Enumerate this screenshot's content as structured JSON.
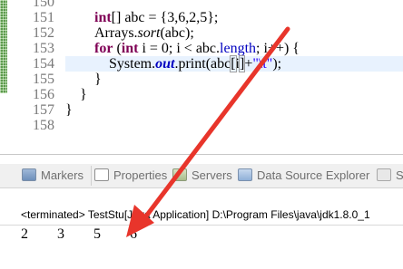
{
  "editor": {
    "line_numbers": [
      "150",
      "151",
      "152",
      "153",
      "154",
      "155",
      "156",
      "157",
      "158"
    ],
    "code": {
      "l151": {
        "kw": "int",
        "rest": "[] abc = {3,6,2,5};"
      },
      "l152": {
        "prefix": "Arrays.",
        "method": "sort",
        "rest": "(abc);"
      },
      "l153": {
        "kw1": "for",
        "open": " (",
        "kw2": "int",
        "mid": " i = 0; i < abc.",
        "field": "length",
        "rest": "; i++) {"
      },
      "l154": {
        "prefix": "System.",
        "field": "out",
        "mid": ".print(abc",
        "bracket_open": "[",
        "idx": "i",
        "bracket_close": "]",
        "plus": "+",
        "str": "\"\\t\"",
        "rest": ");"
      },
      "l155": {
        "text": "}"
      },
      "l156": {
        "text": "}"
      },
      "l157": {
        "text": "}"
      }
    }
  },
  "views": {
    "tabs": [
      {
        "label": "Markers",
        "icon": "markers-icon"
      },
      {
        "label": "Properties",
        "icon": "properties-icon"
      },
      {
        "label": "Servers",
        "icon": "servers-icon"
      },
      {
        "label": "Data Source Explorer",
        "icon": "data-source-explorer-icon"
      },
      {
        "label": "S",
        "icon": "snippets-icon"
      }
    ],
    "console": {
      "header": "<terminated> TestStu[Java Application] D:\\Program Files\\java\\jdk1.8.0_1",
      "output": "2\t3\t5\t6"
    }
  },
  "annotation": {
    "arrow_color": "#e8352b"
  }
}
